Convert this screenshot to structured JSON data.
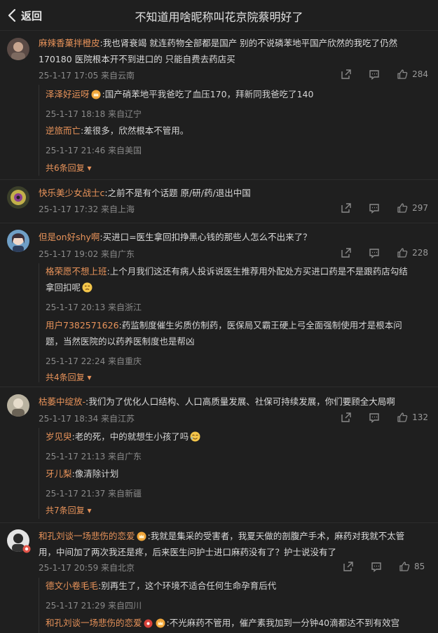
{
  "header": {
    "back_label": "返回",
    "title": "不知道用啥昵称叫花京院蔡明好了"
  },
  "comments": [
    {
      "user": "麻辣香菓拌橙皮",
      "text": ":我也肾衰竭 就连药物全部都是国产 别的不说磷苯地平国产欣然的我吃了仍然170180 医院根本开不到进口的 只能自费去药店买",
      "text_line1": ":我也肾衰竭 就连药物全部都是国产 别的不说磷苯地平国产欣然的我吃了仍然",
      "text_line2": "170180 医院根本开不到进口的 只能自费去药店买",
      "time": "25-1-17 17:05 来自云南",
      "likes": "284",
      "replies": [
        {
          "user": "泽泽好运呀",
          "text": ":国产硝苯地平我爸吃了血压170，拜新同我爸吃了140",
          "time": "25-1-17 18:18 来自辽宁"
        },
        {
          "user": "逆旅而亡",
          "text": ":差很多，欣然根本不管用。",
          "time": "25-1-17 21:46 来自美国"
        }
      ],
      "more": "共6条回复"
    },
    {
      "user": "快乐美少女战士c",
      "text": ":之前不是有个话题 原/研/药/退出中国",
      "time": "25-1-17 17:32 来自上海",
      "likes": "297"
    },
    {
      "user": "但是on好shy啊",
      "text": ":买进口=医生拿回扣挣黑心钱的那些人怎么不出来了？",
      "time": "25-1-17 19:02 来自广东",
      "likes": "228",
      "replies": [
        {
          "user": "格荣愿不想上班",
          "text": ":上个月我们这还有病人投诉说医生推荐用外配处方买进口药是不是跟药店勾结",
          "text2": "拿回扣呢",
          "time": "25-1-17 20:13 来自浙江"
        },
        {
          "user": "用户7382571626",
          "text": ":药监制度催生劣质仿制药，医保局又霸王硬上弓全面强制使用才是根本问",
          "text2": "题，当然医院的以药养医制度也是帮凶",
          "time": "25-1-17 22:24 来自重庆"
        }
      ],
      "more": "共4条回复"
    },
    {
      "user": "枯萎中绽放-",
      "text": ":我们为了优化人口结构、人口高质量发展、社保可持续发展，你们要顾全大局啊",
      "time": "25-1-17 18:34 来自江苏",
      "likes": "132",
      "replies": [
        {
          "user": "岁见臾",
          "text": ":老的死，中的就想生小孩了吗",
          "time": "25-1-17 21:13 来自广东"
        },
        {
          "user": "牙儿梨",
          "text": ":像清除计划",
          "time": "25-1-17 21:37 来自新疆"
        }
      ],
      "more": "共7条回复"
    },
    {
      "user": "和孔刘谈一场悲伤的恋爱",
      "text_line1": ":我就是集采的受害者，我夏天做的剖腹产手术，麻药对我就不太管",
      "text_line2": "用，中间加了两次我还是疼，后来医生问护士进口麻药没有了？护士说没有了",
      "time": "25-1-17 20:59 来自北京",
      "likes": "85",
      "replies": [
        {
          "user": "德文小卷毛毛",
          "text": ":别再生了，这个环境不适合任何生命孕育后代",
          "time": "25-1-17 21:29 来自四川"
        },
        {
          "user": "和孔刘谈一场悲伤的恋爱",
          "text": ":不光麻药不管用，催产素我加到一分钟40滴都达不到有效宫"
        }
      ]
    }
  ],
  "colors": {
    "background": "#1f1f1f",
    "username": "#e8935a",
    "meta": "#8a8a8a"
  },
  "icons": [
    "chevron-left-icon",
    "share-icon",
    "comment-icon",
    "like-icon",
    "vip-crown-icon",
    "emoji-icon"
  ]
}
